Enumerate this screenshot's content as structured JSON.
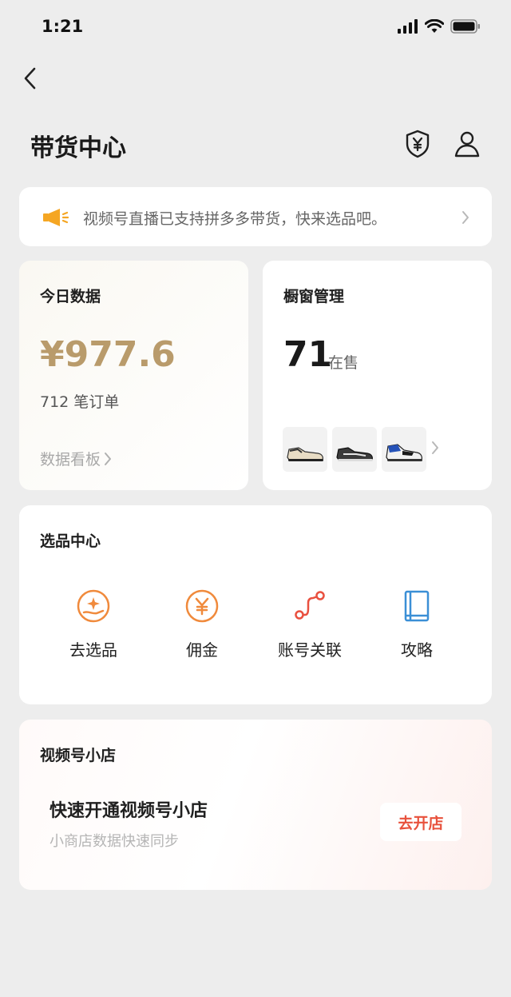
{
  "status_bar": {
    "time": "1:21"
  },
  "header": {
    "title": "带货中心"
  },
  "notice": {
    "text": "视频号直播已支持拼多多带货，快来选品吧。"
  },
  "today_data": {
    "title": "今日数据",
    "amount": "¥977.6",
    "orders": "712 笔订单",
    "dashboard_link": "数据看板"
  },
  "window_management": {
    "title": "橱窗管理",
    "count": "71",
    "status": "在售"
  },
  "selection_center": {
    "title": "选品中心",
    "tools": [
      {
        "label": "去选品",
        "icon": "hand-sparkle-icon",
        "color": "#f08a3c"
      },
      {
        "label": "佣金",
        "icon": "yen-coin-icon",
        "color": "#f08a3c"
      },
      {
        "label": "账号关联",
        "icon": "link-path-icon",
        "color": "#e9503f"
      },
      {
        "label": "攻略",
        "icon": "book-icon",
        "color": "#3b8fd6"
      }
    ]
  },
  "video_shop": {
    "title": "视频号小店",
    "headline": "快速开通视频号小店",
    "subtitle": "小商店数据快速同步",
    "button": "去开店"
  },
  "colors": {
    "accent_gold": "#b99b6b",
    "accent_red": "#e8513c",
    "notice_icon": "#f5a623"
  }
}
